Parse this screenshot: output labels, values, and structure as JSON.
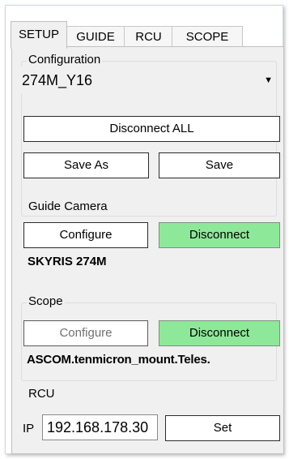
{
  "tabs": [
    "SETUP",
    "GUIDE",
    "RCU",
    "SCOPE"
  ],
  "configuration": {
    "title": "Configuration",
    "selected": "274M_Y16",
    "disconnect_all": "Disconnect ALL",
    "save_as": "Save As",
    "save": "Save"
  },
  "guide_camera": {
    "title": "Guide Camera",
    "configure": "Configure",
    "disconnect": "Disconnect",
    "device": "SKYRIS 274M"
  },
  "scope": {
    "title": "Scope",
    "configure": "Configure",
    "disconnect": "Disconnect",
    "device": "ASCOM.tenmicron_mount.Teles."
  },
  "rcu": {
    "title": "RCU",
    "ip_label": "IP",
    "ip_value": "192.168.178.30",
    "set": "Set"
  },
  "colors": {
    "panel_bg": "#f0f0f0",
    "connected_green": "#8ee89a"
  }
}
